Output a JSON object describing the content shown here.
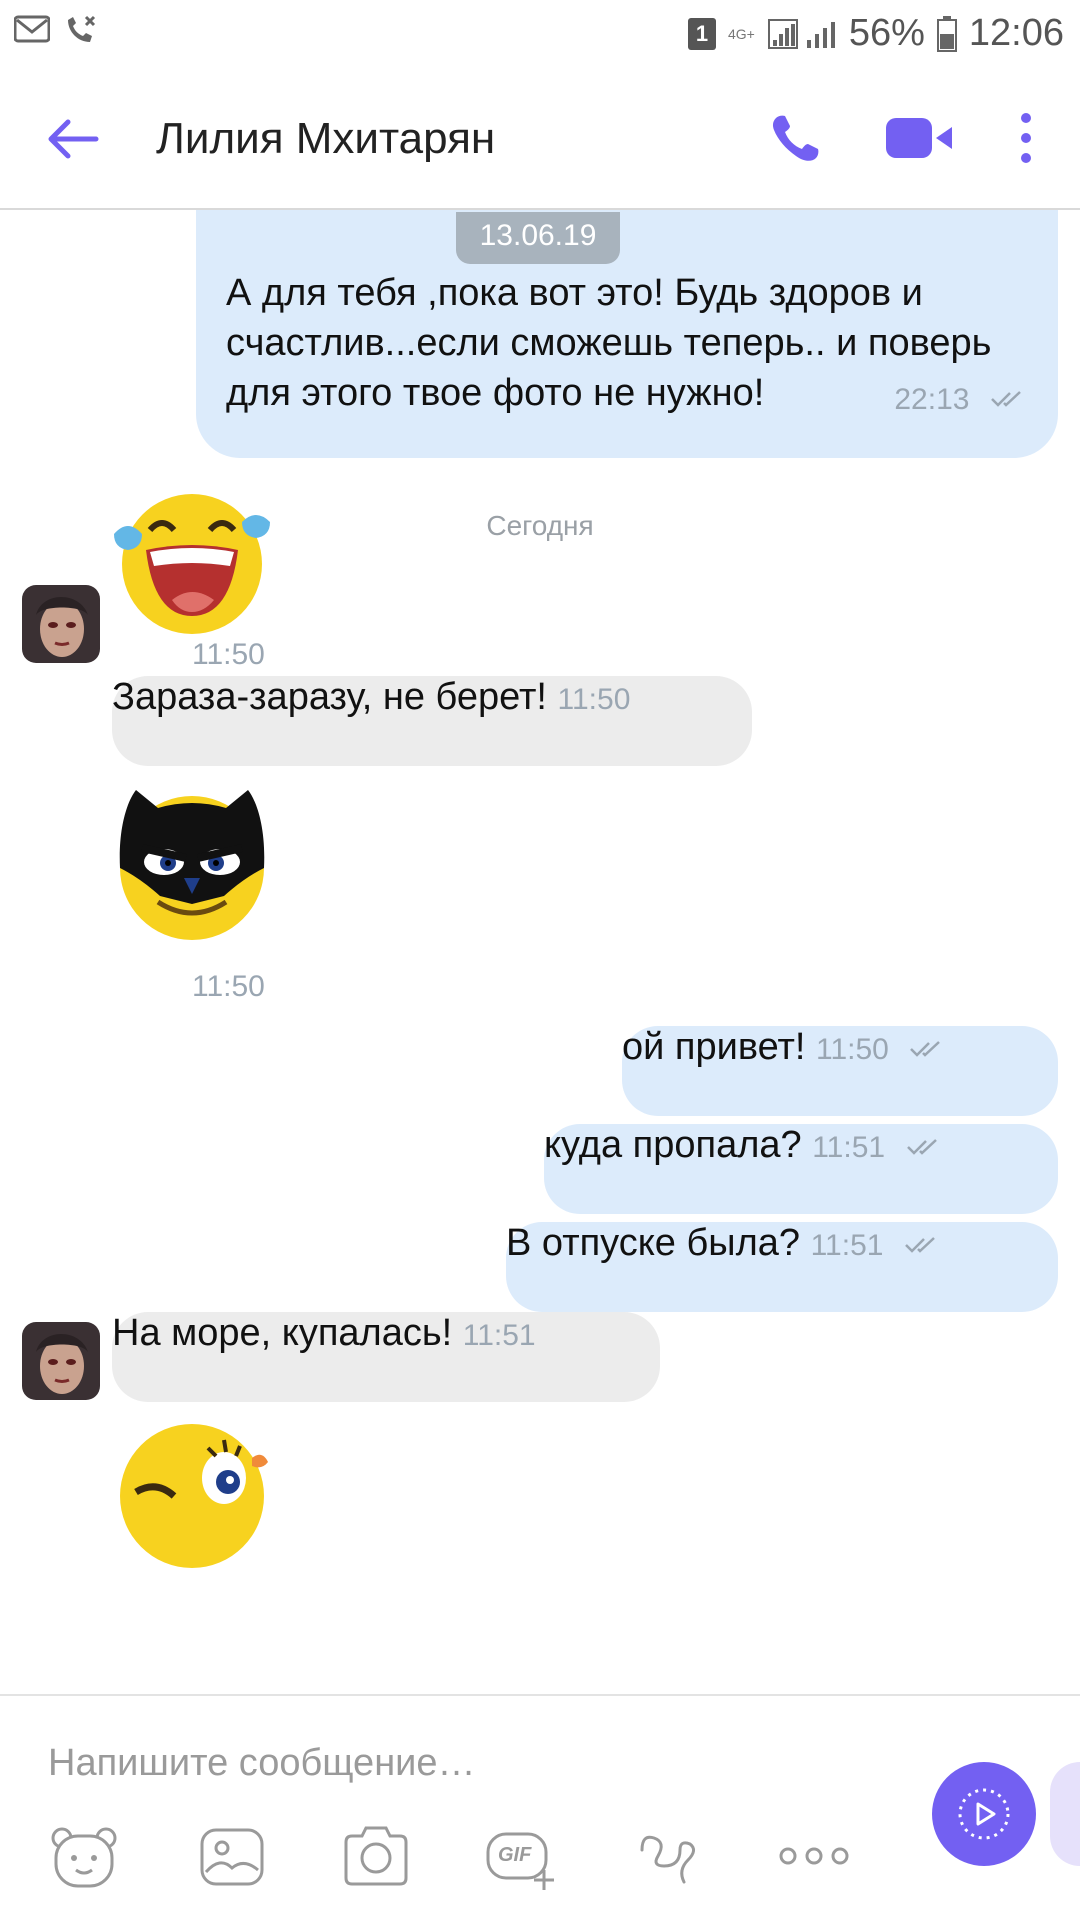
{
  "status_bar": {
    "sim_slot": "1",
    "network": "4G+",
    "battery": "56%",
    "time": "12:06"
  },
  "header": {
    "contact_name": "Лилия Мхитарян",
    "icons": [
      "back-arrow-icon",
      "phone-icon",
      "video-call-icon",
      "more-vertical-icon"
    ],
    "accent_color": "#7360f2"
  },
  "conversation": {
    "date_chip": "13.06.19",
    "first_message": {
      "text": "А для тебя ,пока вот это! Будь здоров и счастлив...если сможешь теперь.. и поверь для этого твое фото не нужно!",
      "time": "22:13"
    },
    "day_separator": "Сегодня",
    "messages": [
      {
        "direction": "in",
        "type": "sticker",
        "sticker": "laughing-tears-emoji",
        "time": "11:50"
      },
      {
        "direction": "in",
        "type": "text",
        "text": "Зараза-заразу, не берет!",
        "time": "11:50"
      },
      {
        "direction": "in",
        "type": "sticker",
        "sticker": "batman-emoji",
        "time": "11:50"
      },
      {
        "direction": "out",
        "type": "text",
        "text": "ой привет!",
        "time": "11:50"
      },
      {
        "direction": "out",
        "type": "text",
        "text": "куда пропала?",
        "time": "11:51"
      },
      {
        "direction": "out",
        "type": "text",
        "text": "В отпуске была?",
        "time": "11:51"
      },
      {
        "direction": "in",
        "type": "text",
        "text": "На море, купалась!",
        "time": "11:51"
      },
      {
        "direction": "in",
        "type": "sticker",
        "sticker": "winking-emoji"
      }
    ]
  },
  "composer": {
    "placeholder": "Напишите сообщение…",
    "tools": [
      "sticker-bear-icon",
      "gallery-icon",
      "camera-icon",
      "gif-icon",
      "doodle-icon",
      "more-horizontal-icon"
    ],
    "tool_gif_label": "GIF"
  }
}
